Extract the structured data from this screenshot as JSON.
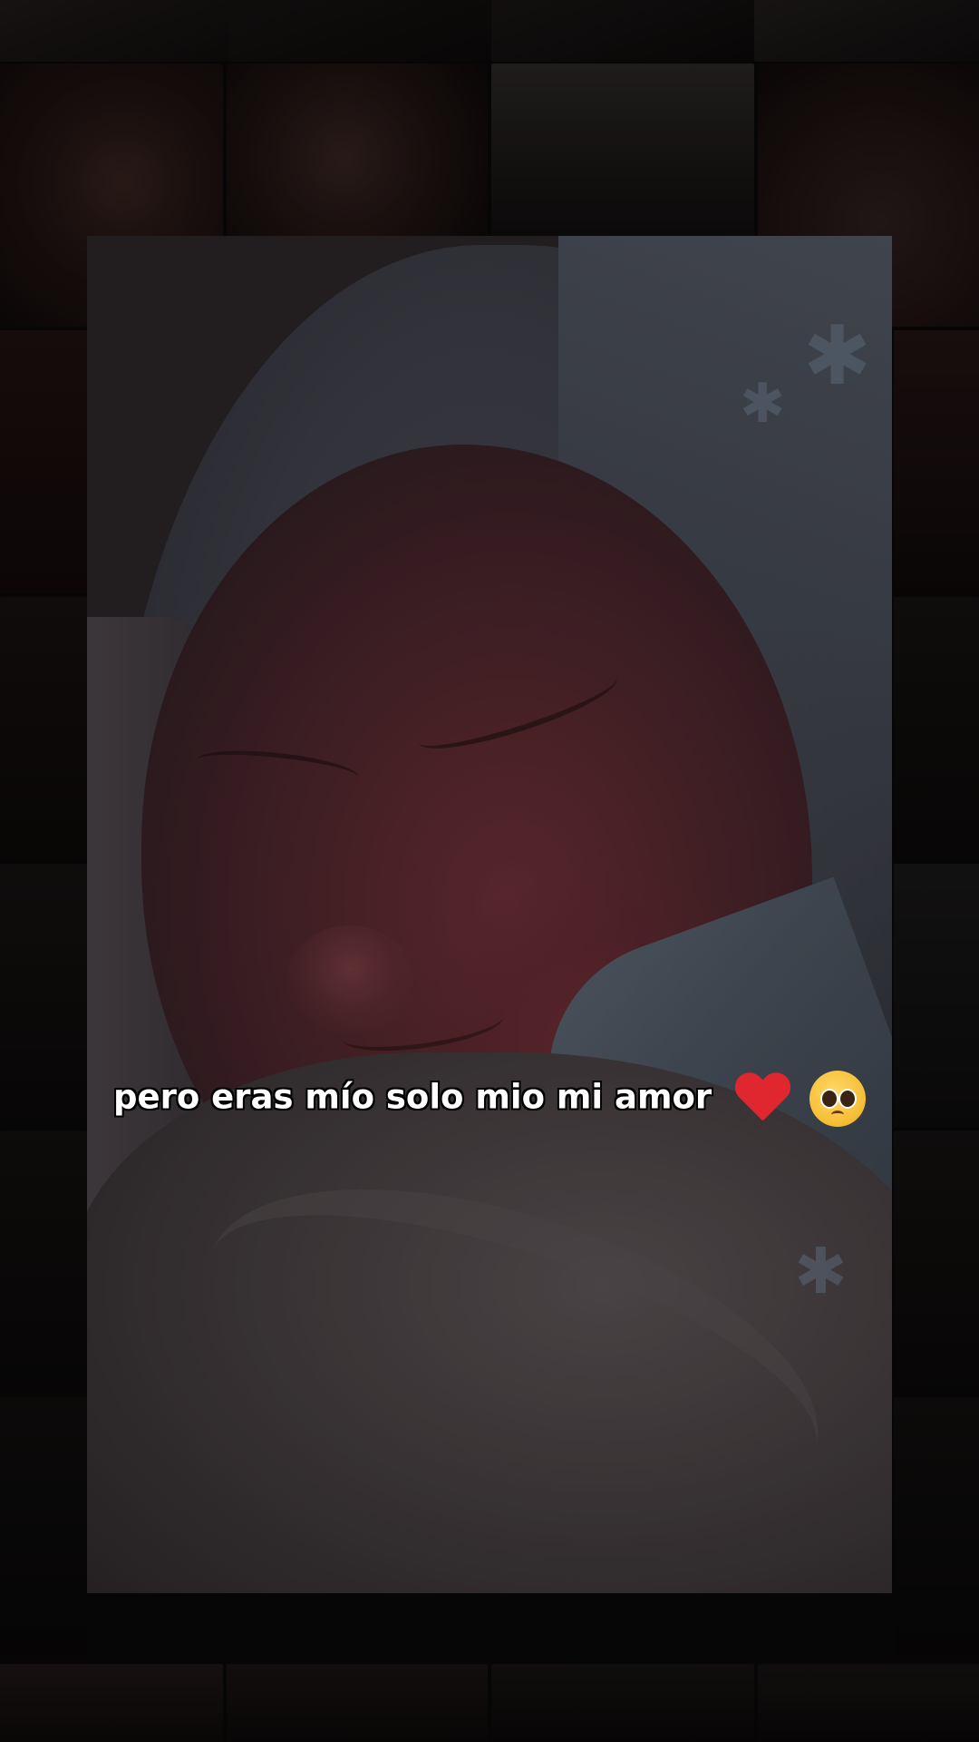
{
  "caption": {
    "text": "pero eras mío solo mio mi amor",
    "emojis": [
      "red-heart",
      "pleading-face"
    ]
  },
  "colors": {
    "caption_text": "#ffffff",
    "caption_outline": "#000000",
    "heart": "#e0262e",
    "background": "#0b0b0b"
  }
}
